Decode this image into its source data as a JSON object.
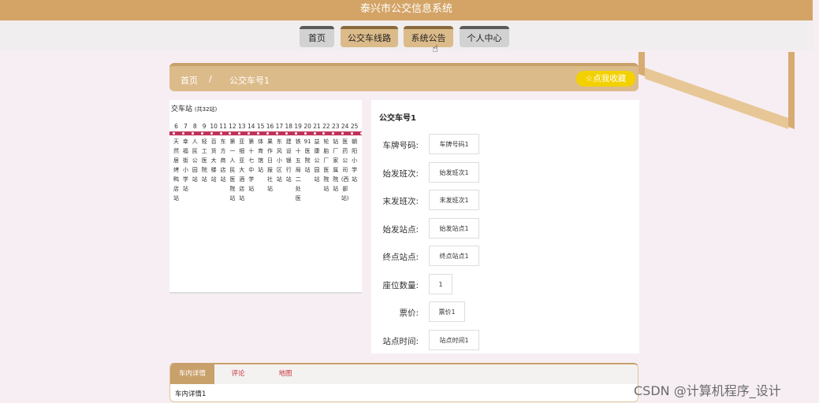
{
  "header": {
    "title": "泰兴市公交信息系统"
  },
  "nav": {
    "items": [
      "首页",
      "公交车线路",
      "系统公告",
      "个人中心"
    ]
  },
  "breadcrumb": {
    "home": "首页",
    "sep": "/",
    "current": "公交车号1"
  },
  "favorite": {
    "label": "☆点我收藏"
  },
  "route": {
    "title": "交车站",
    "count": "(共32站)",
    "numbers": [
      "6",
      "7",
      "8",
      "9",
      "10",
      "11",
      "12",
      "13",
      "14",
      "15",
      "16",
      "17",
      "18",
      "19",
      "20",
      "21",
      "22",
      "23",
      "24",
      "25"
    ],
    "stations": [
      "天然居烤鸭店站",
      "幸福街小学站",
      "人民公园站",
      "轻工医院站",
      "百货大楼站",
      "东方商店站",
      "第一人民医院站",
      "亚细亚大酒店站",
      "第十七中学站",
      "体育馆站",
      "果作日报社站",
      "东风小区站",
      "建设银行站",
      "铁十五局二处医",
      "91医院站",
      "益康公园站",
      "轮胎厂医院站",
      "钻厂家属院站",
      "医药公司(西部站)",
      "朝阳小学站"
    ]
  },
  "info": {
    "title": "公交车号1",
    "fields": [
      {
        "label": "车牌号码:",
        "value": "车牌号码1"
      },
      {
        "label": "始发班次:",
        "value": "始发班次1"
      },
      {
        "label": "末发班次:",
        "value": "末发班次1"
      },
      {
        "label": "始发站点:",
        "value": "始发站点1"
      },
      {
        "label": "终点站点:",
        "value": "终点站点1"
      },
      {
        "label": "座位数量:",
        "value": "1"
      },
      {
        "label": "票价:",
        "value": "票价1"
      },
      {
        "label": "站点时间:",
        "value": "站点时间1"
      }
    ]
  },
  "tabs": {
    "items": [
      "车内详情",
      "评论",
      "地图"
    ],
    "content": "车内详情1"
  },
  "watermark": "CSDN @计算机程序_设计",
  "colors": {
    "accent": "#d4a466",
    "line": "#c0325a",
    "favorite": "#f3d100"
  }
}
